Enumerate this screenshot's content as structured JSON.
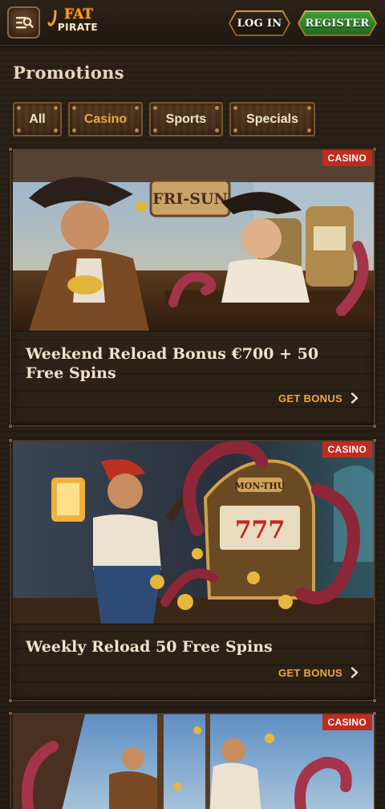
{
  "header": {
    "logo_top": "FAT",
    "logo_bottom": "PIRATE",
    "login_label": "LOG IN",
    "register_label": "REGISTER",
    "menu_icon": "menu-search-icon"
  },
  "page": {
    "title": "Promotions"
  },
  "filters": [
    {
      "label": "All",
      "active": false
    },
    {
      "label": "Casino",
      "active": true
    },
    {
      "label": "Sports",
      "active": false
    },
    {
      "label": "Specials",
      "active": false
    }
  ],
  "promotions": [
    {
      "badge": "CASINO",
      "sign_text": "FRI-SUN",
      "title": "Weekend Reload Bonus €700 + 50 Free Spins",
      "cta": "GET BONUS"
    },
    {
      "badge": "CASINO",
      "sign_text": "MON-THU",
      "title": "Weekly Reload 50 Free Spins",
      "cta": "GET BONUS"
    },
    {
      "badge": "CASINO"
    }
  ],
  "colors": {
    "accent": "#f0a73a",
    "badge": "#c32a1e",
    "register_green": "#2f8a2b",
    "background": "#241b13"
  }
}
